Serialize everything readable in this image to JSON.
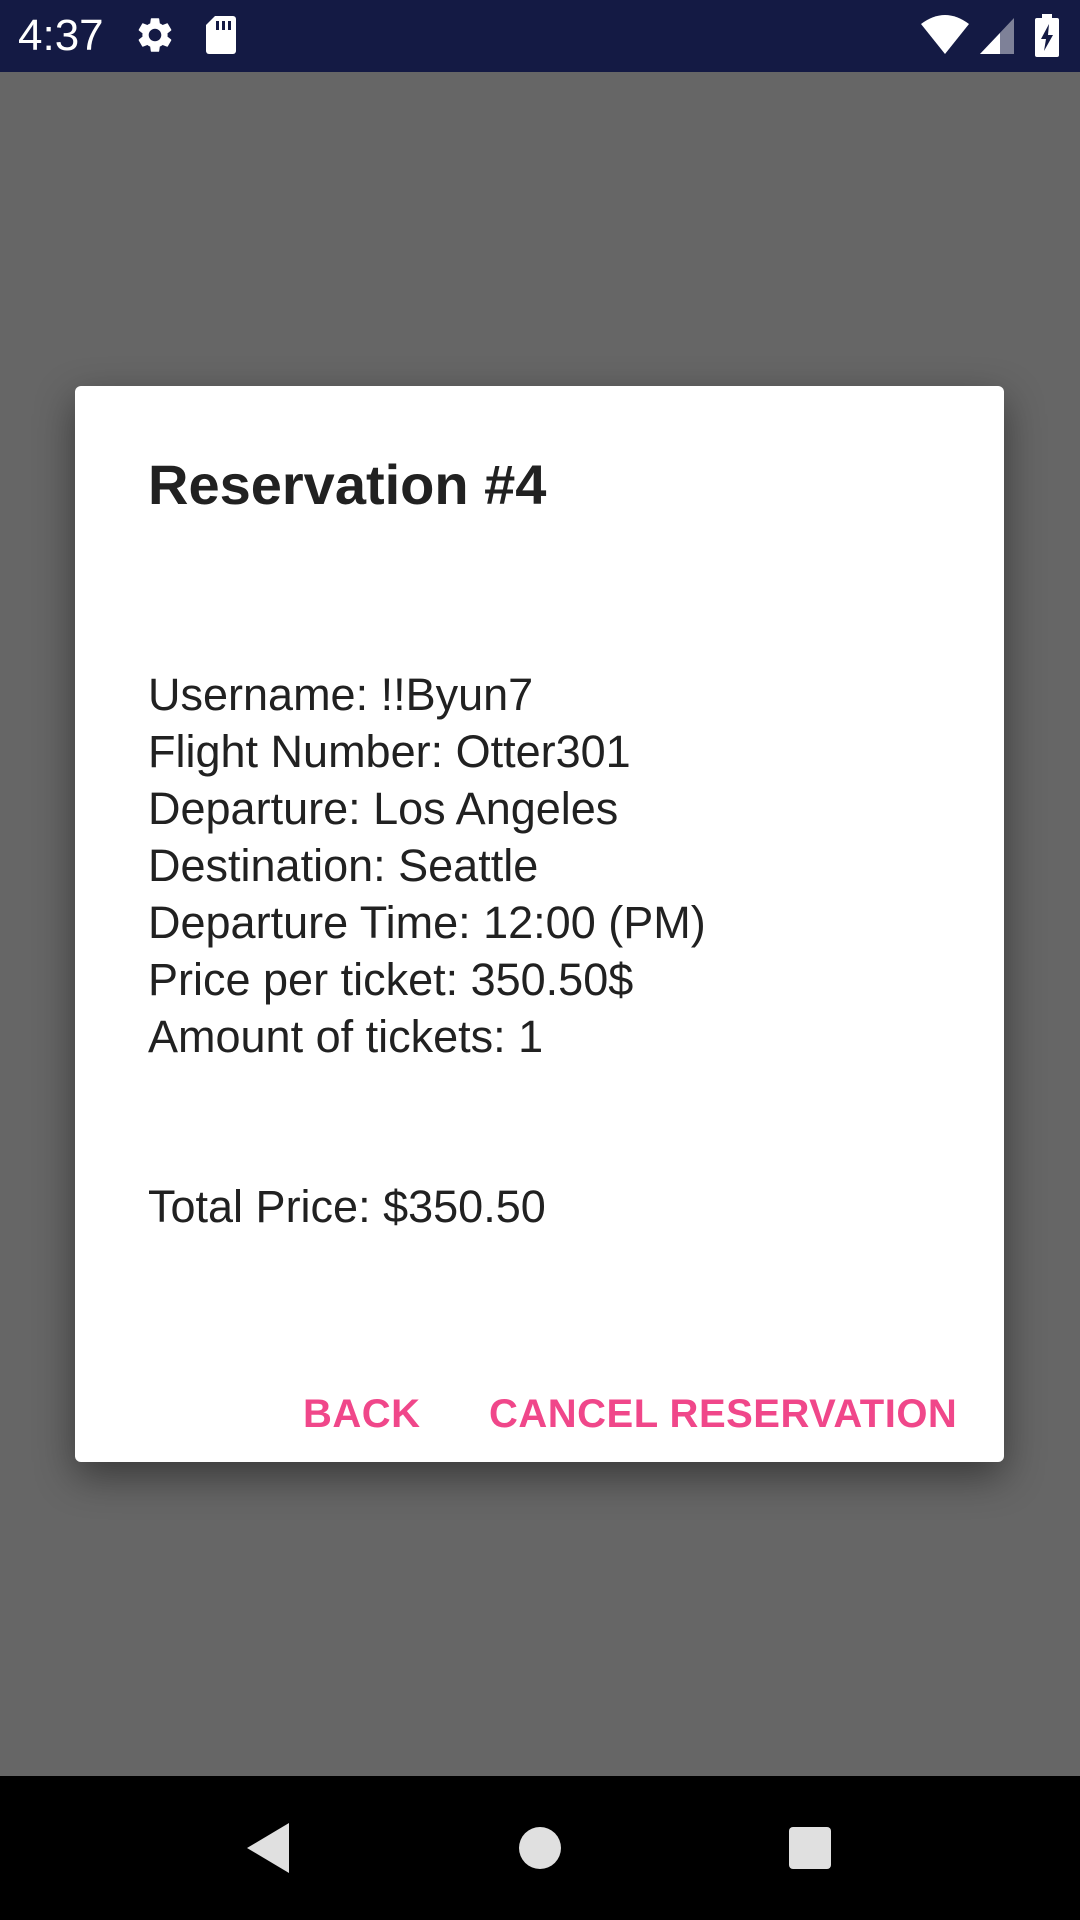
{
  "status_bar": {
    "time": "4:37",
    "icons": [
      "settings-icon",
      "sd-card-icon",
      "wifi-icon",
      "signal-icon",
      "battery-charging-icon"
    ],
    "background": "#141a44"
  },
  "dialog": {
    "title": "Reservation #4",
    "details": [
      "Username: !!Byun7",
      "Flight Number: Otter301",
      "Departure: Los Angeles",
      "Destination: Seattle",
      "Departure Time: 12:00 (PM)",
      "Price per ticket: 350.50$",
      "Amount of tickets: 1"
    ],
    "total_price": "Total Price: $350.50",
    "buttons": {
      "back": "BACK",
      "cancel": "CANCEL RESERVATION"
    },
    "accent_color": "#f0478a"
  },
  "nav_bar": {
    "icons": [
      "back-icon",
      "home-icon",
      "recents-icon"
    ]
  }
}
